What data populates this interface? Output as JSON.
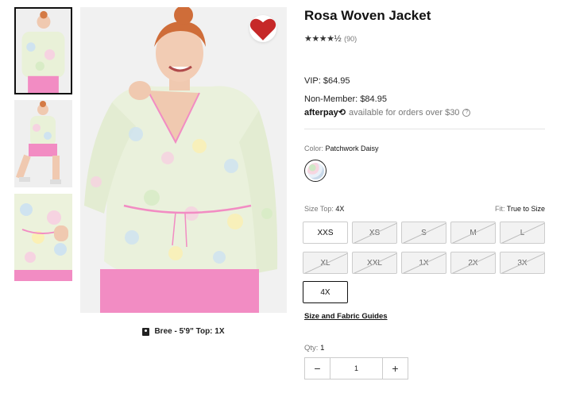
{
  "product": {
    "title": "Rosa Woven Jacket",
    "rating_stars": "★★★★½",
    "review_count": "(90)"
  },
  "pricing": {
    "vip_label": "VIP:",
    "vip_price": "$64.95",
    "member_label": "Non-Member:",
    "member_price": "$84.95",
    "afterpay_logo": "afterpay⟲",
    "afterpay_text": "available for orders over $30",
    "help_glyph": "?"
  },
  "color": {
    "label": "Color:",
    "value": "Patchwork Daisy"
  },
  "size": {
    "label": "Size Top:",
    "value": "4X",
    "fit_label": "Fit:",
    "fit_value": "True to Size",
    "options": [
      {
        "label": "XXS",
        "state": "available"
      },
      {
        "label": "XS",
        "state": "sold-out"
      },
      {
        "label": "S",
        "state": "sold-out"
      },
      {
        "label": "M",
        "state": "sold-out"
      },
      {
        "label": "L",
        "state": "sold-out"
      },
      {
        "label": "XL",
        "state": "sold-out"
      },
      {
        "label": "XXL",
        "state": "sold-out"
      },
      {
        "label": "1X",
        "state": "sold-out"
      },
      {
        "label": "2X",
        "state": "sold-out"
      },
      {
        "label": "3X",
        "state": "sold-out"
      },
      {
        "label": "4X",
        "state": "selected"
      }
    ],
    "guide_link": "Size and Fabric Guides"
  },
  "quantity": {
    "label": "Qty:",
    "value": "1",
    "minus_glyph": "−",
    "plus_glyph": "+",
    "field_value": "1"
  },
  "gallery": {
    "model_caption": "Bree - 5'9\" Top: 1X"
  },
  "colors": {
    "favorite": "#c62828",
    "selected_border": "#111111"
  },
  "icons": {
    "favorite": "heart-icon",
    "model": "model-info-icon"
  }
}
